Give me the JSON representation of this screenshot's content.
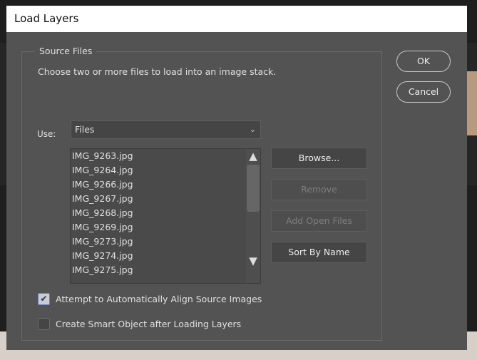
{
  "dialog": {
    "title": "Load Layers"
  },
  "source_files": {
    "legend": "Source Files",
    "description": "Choose two or more files to load into an image stack.",
    "use_label": "Use:",
    "use_value": "Files",
    "files": [
      "IMG_9263.jpg",
      "IMG_9264.jpg",
      "IMG_9266.jpg",
      "IMG_9267.jpg",
      "IMG_9268.jpg",
      "IMG_9269.jpg",
      "IMG_9273.jpg",
      "IMG_9274.jpg",
      "IMG_9275.jpg"
    ],
    "buttons": {
      "browse": "Browse...",
      "remove": "Remove",
      "add_open_files": "Add Open Files",
      "sort_by_name": "Sort By Name"
    }
  },
  "actions": {
    "ok": "OK",
    "cancel": "Cancel"
  },
  "options": {
    "align": {
      "label": "Attempt to Automatically Align Source Images",
      "checked": true
    },
    "smart_object": {
      "label": "Create Smart Object after Loading Layers",
      "checked": false
    }
  }
}
